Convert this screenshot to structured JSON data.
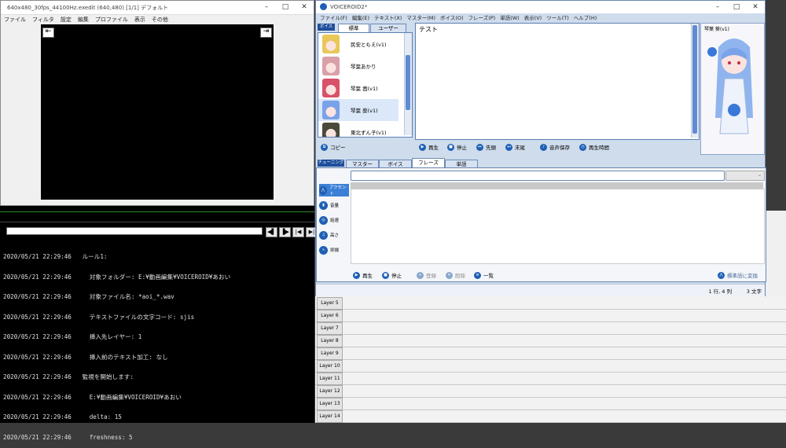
{
  "aviutl": {
    "title": "640x480_30fps_44100Hz.exedit (640,480)  [1/1]  デフォルト",
    "menu": [
      "ファイル",
      "フィルタ",
      "設定",
      "編集",
      "プロファイル",
      "表示",
      "その他"
    ],
    "nav_left": "⇤",
    "nav_right": "⇥",
    "seek_buttons": [
      "◀▌",
      "▐▶",
      "|◀",
      "▶|"
    ]
  },
  "console": {
    "lines": [
      "2020/05/21 22:29:46   ルール1:",
      "2020/05/21 22:29:46     対象フォルダー: E:¥動画編集¥VOICEROID¥あおい",
      "2020/05/21 22:29:46     対象ファイル名: *aoi_*.wav",
      "2020/05/21 22:29:46     テキストファイルの文字コード: sjis",
      "2020/05/21 22:29:46     挿入先レイヤー: 1",
      "2020/05/21 22:29:46     挿入前のテキスト加工: なし",
      "2020/05/21 22:29:46   監視を開始します:",
      "2020/05/21 22:29:46     E:¥動画編集¥VOICEROID¥あおい",
      "2020/05/21 22:29:46     delta: 15",
      "2020/05/21 22:29:46     freshness: 5"
    ]
  },
  "voiceroid": {
    "title": "VOICEROID2*",
    "menu": [
      "ファイル(F)",
      "編集(E)",
      "テキスト(X)",
      "マスター(M)",
      "ボイス(O)",
      "フレーズ(P)",
      "単語(W)",
      "表示(V)",
      "ツール(T)",
      "ヘルプ(H)"
    ],
    "voice_tag": "ボイス",
    "voice_tabs": [
      "標準",
      "ユーザー"
    ],
    "characters": [
      {
        "name": "民安ともえ(v1)",
        "color": "#e9c75a"
      },
      {
        "name": "琴葉あかり",
        "color": "#d9a0a8"
      },
      {
        "name": "琴葉 茜(v1)",
        "color": "#d8526a"
      },
      {
        "name": "琴葉 葵(v1)",
        "color": "#7aa2e8"
      },
      {
        "name": "東北ずん子(v1)",
        "color": "#4a4a3a"
      }
    ],
    "copy_label": "コピー",
    "text_content": "テスト",
    "player_buttons": [
      {
        "label": "再生",
        "icon": "play-icon"
      },
      {
        "label": "停止",
        "icon": "stop-icon"
      },
      {
        "label": "先頭",
        "icon": "skip-start-icon"
      },
      {
        "label": "末尾",
        "icon": "skip-end-icon"
      },
      {
        "label": "音声保存",
        "icon": "save-audio-icon"
      },
      {
        "label": "再生時間",
        "icon": "clock-icon"
      }
    ],
    "portrait_label": "琴葉 葵(v1)",
    "tuning_tag": "チューニング",
    "tuning_tabs": [
      "マスター",
      "ボイス",
      "フレーズ",
      "単語"
    ],
    "side_buttons": [
      "アクセント",
      "音量",
      "話速",
      "高さ",
      "抑揚"
    ],
    "bottom_buttons": [
      "再生",
      "停止",
      "登録",
      "削除",
      "一覧"
    ],
    "convert_label": "標準語に変換",
    "status_pos": "1 行, 4 列",
    "status_chars": "3 文字"
  },
  "layers": [
    "Layer 5",
    "Layer 6",
    "Layer 7",
    "Layer 8",
    "Layer 9",
    "Layer 10",
    "Layer 11",
    "Layer 12",
    "Layer 13",
    "Layer 14"
  ],
  "colors": {
    "accent": "#1e5fb4",
    "selection": "#dbe8f9",
    "panel_border": "#5b7fb4"
  }
}
